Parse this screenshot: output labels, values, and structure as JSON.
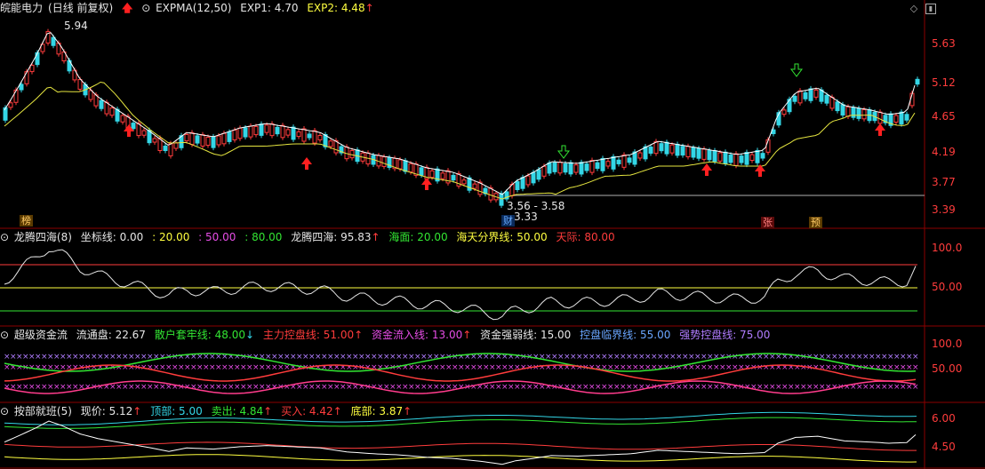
{
  "main": {
    "symbol": "皖能电力",
    "period": "(日线 前复权)",
    "indicator": "EXPMA(12,50)",
    "exp1_label": "EXP1: 4.70",
    "exp2_label": "EXP2: 4.48",
    "high_label": "5.94",
    "low_range_label": "3.56 - 3.58",
    "low_label": "3.33",
    "y_ticks": [
      "5.63",
      "5.12",
      "4.65",
      "4.19",
      "3.77",
      "3.39"
    ],
    "tags": {
      "bang": "榜",
      "cai": "财",
      "zhang": "张",
      "yu": "预"
    }
  },
  "lt": {
    "name": "龙腾四海(8)",
    "coord_label": "坐标线: 0.00",
    "v20": ": 20.00",
    "v50": ": 50.00",
    "v80": ": 80.00",
    "val_label": "龙腾四海: 95.83",
    "haimian": "海面: 20.00",
    "haitian": "海天分界线: 50.00",
    "tianji": "天际: 80.00",
    "y_ticks": [
      "100.0",
      "50.00"
    ]
  },
  "cj": {
    "name": "超级资金流",
    "liutong": "流通盘: 22.67",
    "sanhu": "散户套牢线: 48.00",
    "zhuli": "主力控盘线: 51.00",
    "liuru": "资金流入线: 13.00",
    "qiangruo": "资金强弱线: 15.00",
    "linjie": "控盘临界线: 55.00",
    "qiangshi": "强势控盘线: 75.00",
    "y_ticks": [
      "100.0",
      "50.00"
    ]
  },
  "ab": {
    "name": "按部就班(5)",
    "xianjia": "现价: 5.12",
    "dingbu": "顶部: 5.00",
    "maichu": "卖出: 4.84",
    "mairu": "买入: 4.42",
    "dibu": "底部: 3.87",
    "y_ticks": [
      "6.00",
      "4.50"
    ]
  }
}
